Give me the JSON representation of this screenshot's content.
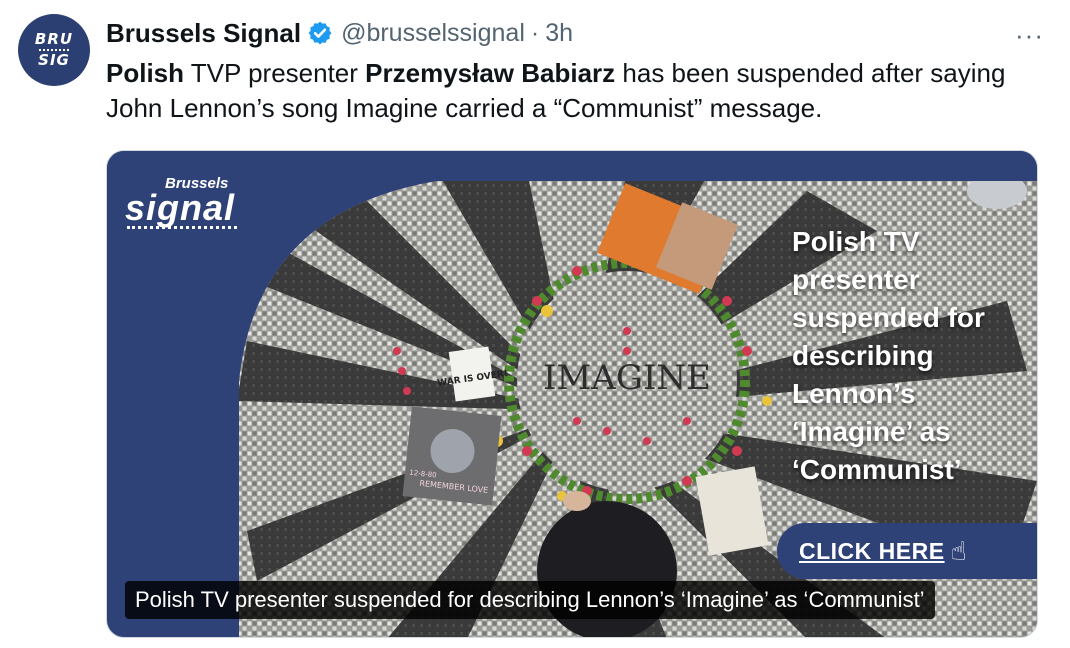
{
  "author": {
    "avatar_line1": "BRU",
    "avatar_line2": "SIG",
    "name": "Brussels Signal",
    "handle": "@brusselssignal",
    "separator": "·",
    "time": "3h",
    "verified_icon": "verified-badge-icon",
    "verified_color": "#1d9bf0"
  },
  "more_label": "···",
  "tweet": {
    "seg1": "Polish",
    "seg2": " TVP presenter ",
    "seg3": "Przemysław Babiarz",
    "seg4": " has been suspended after saying John Lennon’s song Imagine carried a “Communist” message."
  },
  "card": {
    "brand_small": "Brussels",
    "brand_big": "signal",
    "headline_lines": [
      "Polish TV",
      "presenter",
      "suspended for",
      "describing",
      "Lennon’s",
      "‘Imagine’ as",
      "‘Communist’"
    ],
    "cta_label": "CLICK HERE",
    "cta_icon": "pointing-hand-icon",
    "photo_text": "IMAGINE",
    "sign_text": "WAR IS OVER!",
    "record_text": "REMEMBER LOVE",
    "record_date": "12-8-80",
    "caption": "Polish TV presenter suspended for describing Lennon’s ‘Imagine’ as ‘Communist’",
    "brand_color": "#2f4278"
  }
}
